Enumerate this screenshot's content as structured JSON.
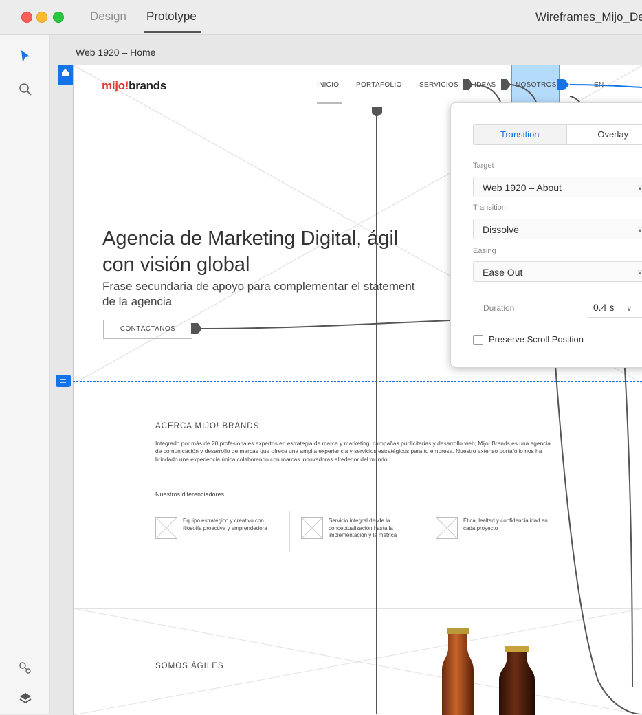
{
  "window": {
    "tabs": [
      "Design",
      "Prototype"
    ],
    "active_tab": "Prototype",
    "title": "Wireframes_Mijo_De"
  },
  "artboard": {
    "label": "Web 1920 – Home"
  },
  "site": {
    "logo_brand": "mijo!",
    "logo_rest": "brands",
    "nav": [
      "INICIO",
      "PORTAFOLIO",
      "SERVICIOS",
      "IDEAS",
      "NOSOTROS",
      "EN"
    ],
    "hero_title": "Agencia de Marketing Digital, ágil con visión global",
    "hero_subtitle": "Frase secundaria de apoyo para complementar el statement de la agencia",
    "cta": "CONTÁCTANOS",
    "about_title": "ACERCA MIJO! BRANDS",
    "about_text": "Integrado por más de 20 profesionales expertos en estrategia de marca y marketing, campañas publicitarias y desarrollo web; Mijo! Brands es una agencia de comunicación y desarrollo de marcas que ofrece una amplia experiencia y servicios estratégicos para tu empresa. Nuestro extenso portafolio nos ha brindado una experiencia única colaborando con marcas innovadoras alrededor del mundo.",
    "diff_title": "Nuestros diferenciadores",
    "differentiators": [
      "Equipo estratégico y creativo con filosofía proactiva y emprendedora",
      "Servicio integral desde la conceptualización hasta la implementación y la métrica",
      "Ética, lealtad y confidencialidad en cada proyecto"
    ],
    "agile_title": "SOMOS ÁGILES"
  },
  "panel": {
    "segments": [
      "Transition",
      "Overlay"
    ],
    "active_segment": "Transition",
    "target_label": "Target",
    "target_value": "Web 1920 – About",
    "transition_label": "Transition",
    "transition_value": "Dissolve",
    "easing_label": "Easing",
    "easing_value": "Ease Out",
    "duration_label": "Duration",
    "duration_value": "0.4 s",
    "preserve_scroll_label": "Preserve Scroll Position",
    "preserve_scroll_checked": false
  },
  "colors": {
    "accent": "#1473e6",
    "logo_red": "#e53935",
    "wire": "#555555"
  }
}
